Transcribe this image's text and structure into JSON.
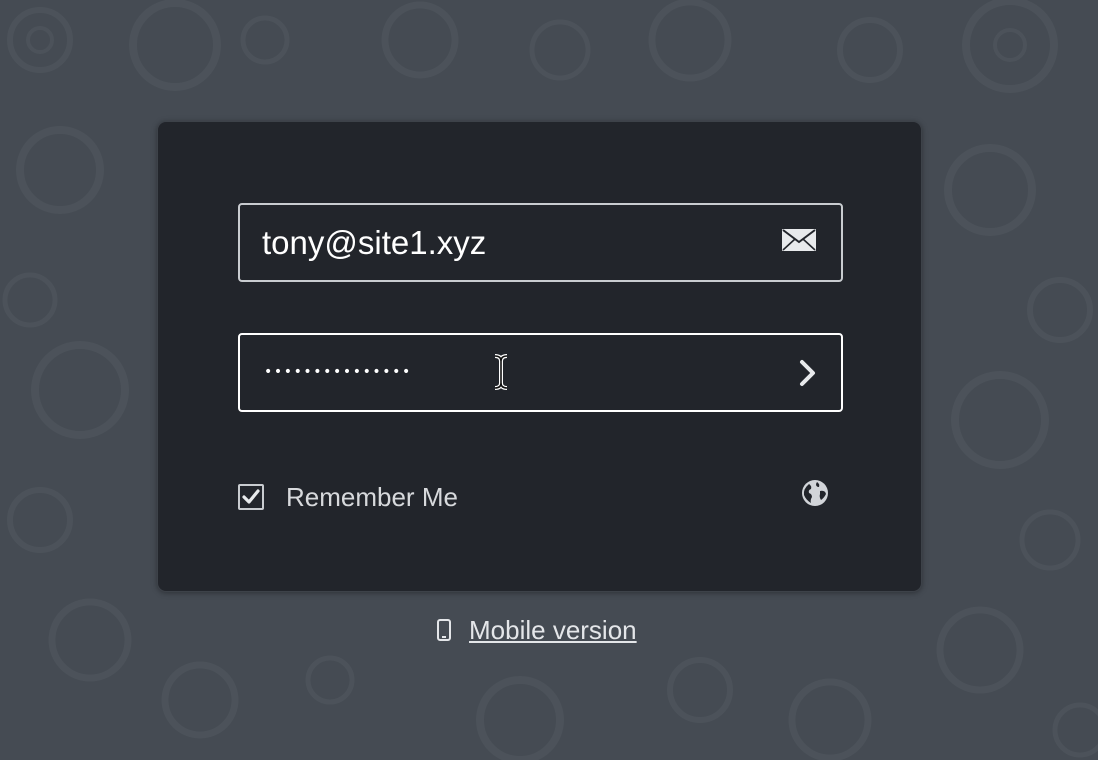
{
  "login_form": {
    "email": {
      "value": "tony@site1.xyz",
      "icon": "envelope-icon"
    },
    "password": {
      "masked_value": "•••••••••••••••",
      "submit_icon": "chevron-right-icon"
    },
    "remember_me": {
      "label": "Remember Me",
      "checked": true
    },
    "language_icon": "globe-icon"
  },
  "footer": {
    "mobile_link_label": "Mobile version",
    "mobile_icon": "phone-icon"
  },
  "colors": {
    "page_background": "#454b53",
    "panel_background": "#22252b",
    "field_border": "#c9ccd0",
    "text": "#ffffff"
  }
}
